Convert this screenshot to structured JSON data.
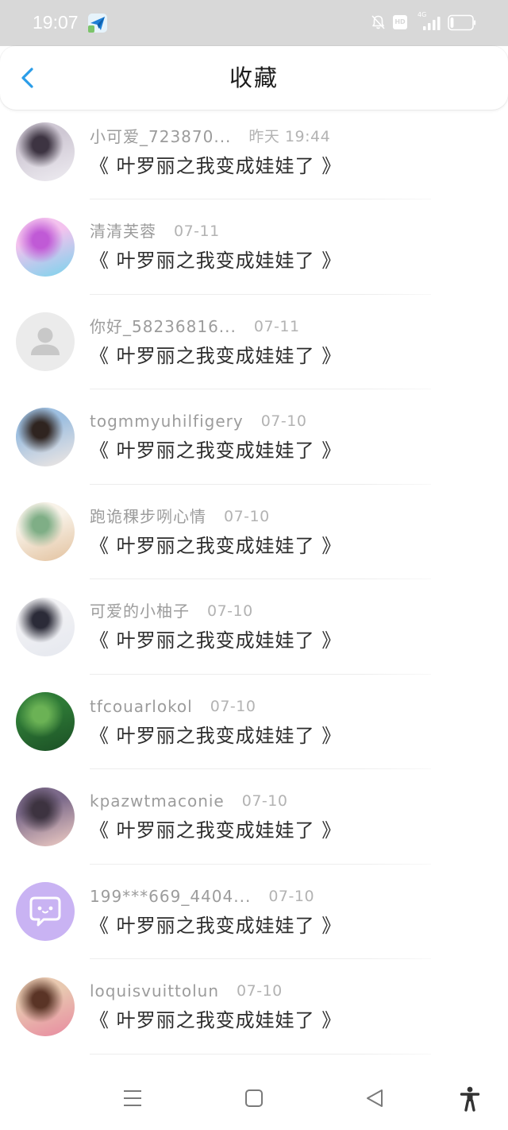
{
  "status_bar": {
    "time": "19:07",
    "app_icon": "paper-plane-icon",
    "mute_icon": "bell-off-icon",
    "hd_badge": "HD",
    "network": "4G",
    "signal_icon": "signal-icon",
    "signal_bars": 4,
    "battery_icon": "battery-icon",
    "battery_level": 0.15
  },
  "header": {
    "back_icon": "chevron-left-icon",
    "title": "收藏"
  },
  "colors": {
    "status_bar_bg": "#d8d8d8",
    "accent": "#2b9de8",
    "name_text": "#9c9c9c",
    "time_text": "#b3b3b3",
    "title_text": "#2d2d2d",
    "divider": "#ededed",
    "nav_icon": "#7a7a7a"
  },
  "favorites": [
    {
      "user": "小可爱_723870...",
      "time": "昨天 19:44",
      "title": "《 叶罗丽之我变成娃娃了 》",
      "avatar": {
        "tones": [
          "#cfc8d4",
          "#3d3442",
          "#efedf2"
        ]
      }
    },
    {
      "user": "清清芙蓉",
      "time": "07-11",
      "title": "《 叶罗丽之我变成娃娃了 》",
      "avatar": {
        "tones": [
          "#f3c2ee",
          "#c05ad6",
          "#78d4ec"
        ]
      }
    },
    {
      "user": "你好_58236816...",
      "time": "07-11",
      "title": "《 叶罗丽之我变成娃娃了 》",
      "avatar": {
        "icon": "person-silhouette-icon",
        "tones": [
          "#ebebeb",
          "#c8c8c8"
        ]
      }
    },
    {
      "user": "togmmyuhilfigery",
      "time": "07-10",
      "title": "《 叶罗丽之我变成娃娃了 》",
      "avatar": {
        "tones": [
          "#9ebfe0",
          "#2f2420",
          "#f1e8e3"
        ]
      }
    },
    {
      "user": "跑诡稞步咧心情",
      "time": "07-10",
      "title": "《 叶罗丽之我变成娃娃了 》",
      "avatar": {
        "tones": [
          "#f8f2e8",
          "#7fae86",
          "#e3c29f"
        ]
      }
    },
    {
      "user": "可爱的小柚子",
      "time": "07-10",
      "title": "《 叶罗丽之我变成娃娃了 》",
      "avatar": {
        "tones": [
          "#f1f1f4",
          "#2b2b38",
          "#e5e8ef"
        ]
      }
    },
    {
      "user": "tfcouarlokol",
      "time": "07-10",
      "title": "《 叶罗丽之我变成娃娃了 》",
      "avatar": {
        "tones": [
          "#2e7a36",
          "#6bb255",
          "#1b4f25"
        ]
      }
    },
    {
      "user": "kpazwtmaconie",
      "time": "07-10",
      "title": "《 叶罗丽之我变成娃娃了 》",
      "avatar": {
        "tones": [
          "#7c6a8a",
          "#3d3340",
          "#f2cfc6"
        ]
      }
    },
    {
      "user": "199***669_4404...",
      "time": "07-10",
      "title": "《 叶罗丽之我变成娃娃了 》",
      "avatar": {
        "icon": "chat-bubble-icon",
        "tones": [
          "#c9b3f3",
          "#ffffff"
        ]
      }
    },
    {
      "user": "loquisvuittolun",
      "time": "07-10",
      "title": "《 叶罗丽之我变成娃娃了 》",
      "avatar": {
        "tones": [
          "#e8c8b0",
          "#5a3426",
          "#e88aa0"
        ]
      }
    }
  ],
  "nav_bar": {
    "items": [
      {
        "icon": "menu-icon"
      },
      {
        "icon": "home-square-icon"
      },
      {
        "icon": "back-triangle-icon"
      },
      {
        "icon": "accessibility-icon"
      }
    ]
  }
}
